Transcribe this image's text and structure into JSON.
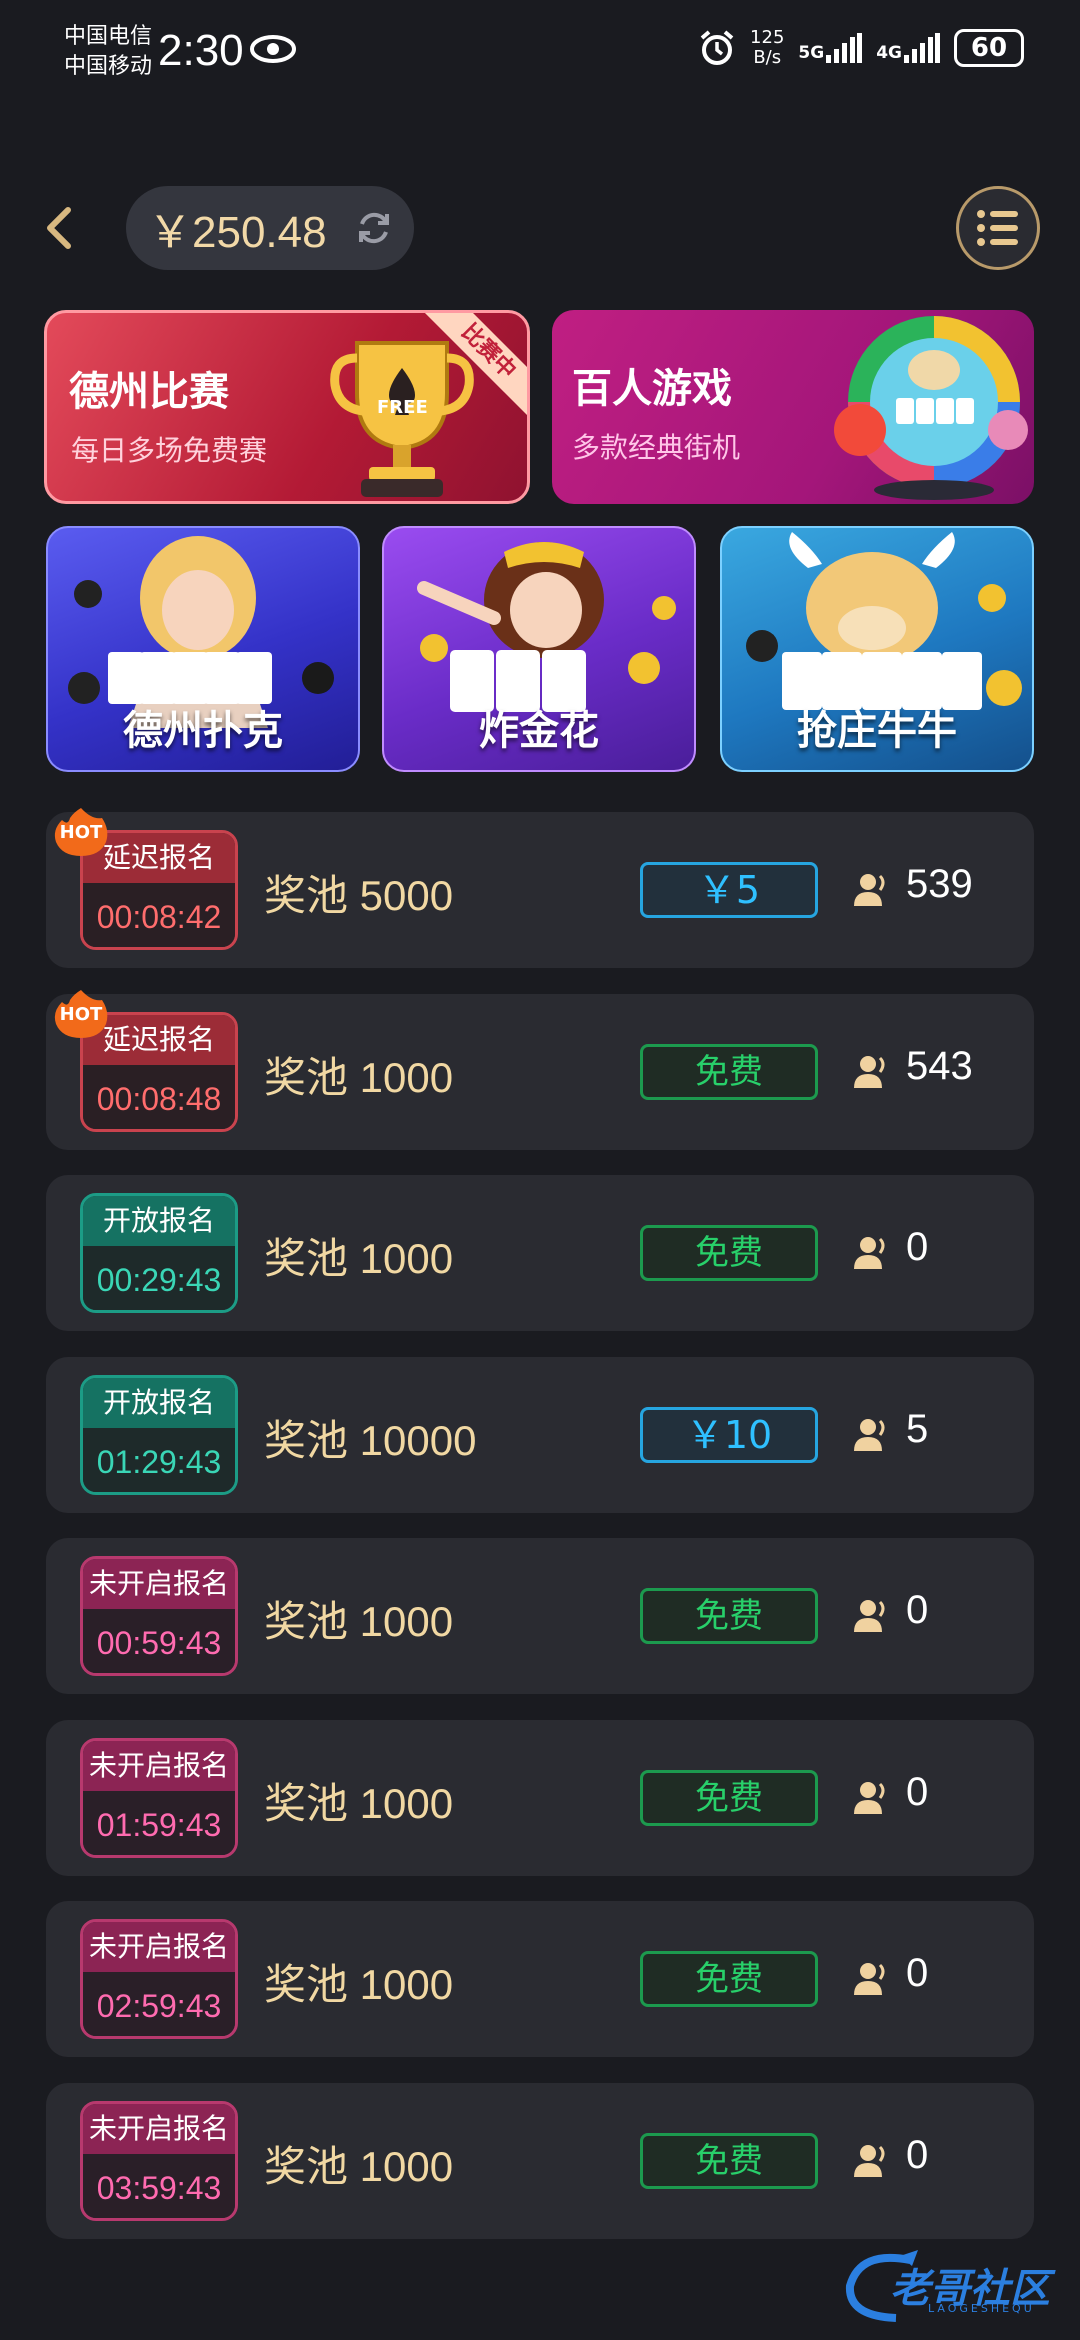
{
  "status_bar": {
    "carrier_1": "中国电信",
    "carrier_2": "中国移动",
    "time": "2:30",
    "net_speed_value": "125",
    "net_speed_unit": "B/s",
    "signal_1": "5G",
    "signal_2": "4G",
    "battery": "60"
  },
  "header": {
    "balance": "￥250.48"
  },
  "banners": [
    {
      "title": "德州比赛",
      "subtitle": "每日多场免费赛",
      "ribbon": "比赛中",
      "trophy_text": "FREE"
    },
    {
      "title": "百人游戏",
      "subtitle": "多款经典街机"
    }
  ],
  "games": [
    {
      "label": "德州扑克"
    },
    {
      "label": "炸金花"
    },
    {
      "label": "抢庄牛牛"
    }
  ],
  "tournaments": [
    {
      "status": "延迟报名",
      "time": "00:08:42",
      "pool": "奖池 5000",
      "fee": "￥5",
      "players": "539",
      "hot": "HOT",
      "kind": "delay",
      "paid": true
    },
    {
      "status": "延迟报名",
      "time": "00:08:48",
      "pool": "奖池 1000",
      "fee": "免费",
      "players": "543",
      "hot": "HOT",
      "kind": "delay",
      "paid": false
    },
    {
      "status": "开放报名",
      "time": "00:29:43",
      "pool": "奖池 1000",
      "fee": "免费",
      "players": "0",
      "hot": "",
      "kind": "open",
      "paid": false
    },
    {
      "status": "开放报名",
      "time": "01:29:43",
      "pool": "奖池 10000",
      "fee": "￥10",
      "players": "5",
      "hot": "",
      "kind": "open",
      "paid": true
    },
    {
      "status": "未开启报名",
      "time": "00:59:43",
      "pool": "奖池 1000",
      "fee": "免费",
      "players": "0",
      "hot": "",
      "kind": "wait",
      "paid": false
    },
    {
      "status": "未开启报名",
      "time": "01:59:43",
      "pool": "奖池 1000",
      "fee": "免费",
      "players": "0",
      "hot": "",
      "kind": "wait",
      "paid": false
    },
    {
      "status": "未开启报名",
      "time": "02:59:43",
      "pool": "奖池 1000",
      "fee": "免费",
      "players": "0",
      "hot": "",
      "kind": "wait",
      "paid": false
    },
    {
      "status": "未开启报名",
      "time": "03:59:43",
      "pool": "奖池 1000",
      "fee": "免费",
      "players": "0",
      "hot": "",
      "kind": "wait",
      "paid": false
    }
  ],
  "watermark": {
    "text": "老哥社区",
    "sub": "LAOGESHEQU"
  }
}
